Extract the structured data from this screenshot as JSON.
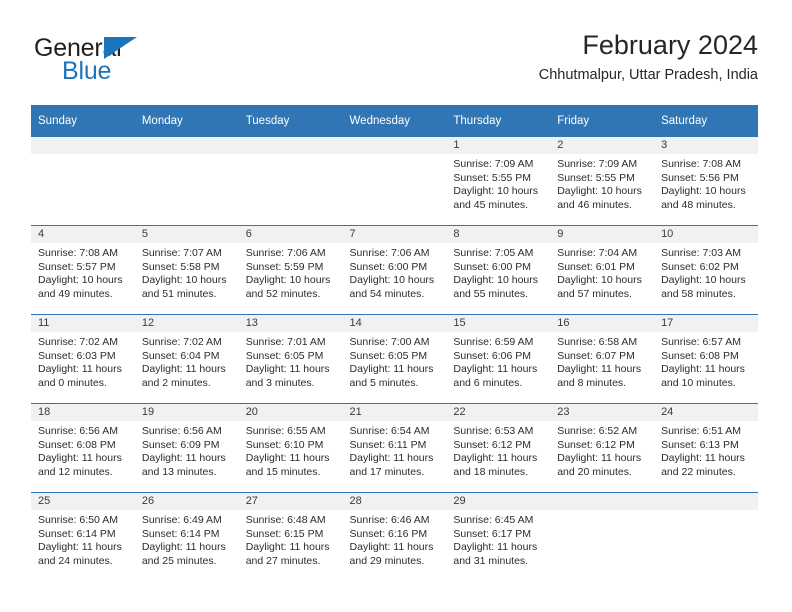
{
  "brand": {
    "name_top": "General",
    "name_bottom": "Blue",
    "flag_icon": "blue-triangle-flag",
    "color_dark": "#231f20",
    "color_blue": "#1b75bb"
  },
  "header": {
    "title": "February 2024",
    "subtitle": "Chhutmalpur, Uttar Pradesh, India"
  },
  "theme": {
    "header_blue": "#3075b4",
    "daynum_band": "#f1f1f1",
    "text": "#2c2c2c"
  },
  "calendar": {
    "weekday_headers": [
      "Sunday",
      "Monday",
      "Tuesday",
      "Wednesday",
      "Thursday",
      "Friday",
      "Saturday"
    ],
    "weeks": [
      [
        {
          "day": "",
          "sunrise": "",
          "sunset": "",
          "daylight_line1": "",
          "daylight_line2": ""
        },
        {
          "day": "",
          "sunrise": "",
          "sunset": "",
          "daylight_line1": "",
          "daylight_line2": ""
        },
        {
          "day": "",
          "sunrise": "",
          "sunset": "",
          "daylight_line1": "",
          "daylight_line2": ""
        },
        {
          "day": "",
          "sunrise": "",
          "sunset": "",
          "daylight_line1": "",
          "daylight_line2": ""
        },
        {
          "day": "1",
          "sunrise": "Sunrise: 7:09 AM",
          "sunset": "Sunset: 5:55 PM",
          "daylight_line1": "Daylight: 10 hours",
          "daylight_line2": "and 45 minutes."
        },
        {
          "day": "2",
          "sunrise": "Sunrise: 7:09 AM",
          "sunset": "Sunset: 5:55 PM",
          "daylight_line1": "Daylight: 10 hours",
          "daylight_line2": "and 46 minutes."
        },
        {
          "day": "3",
          "sunrise": "Sunrise: 7:08 AM",
          "sunset": "Sunset: 5:56 PM",
          "daylight_line1": "Daylight: 10 hours",
          "daylight_line2": "and 48 minutes."
        }
      ],
      [
        {
          "day": "4",
          "sunrise": "Sunrise: 7:08 AM",
          "sunset": "Sunset: 5:57 PM",
          "daylight_line1": "Daylight: 10 hours",
          "daylight_line2": "and 49 minutes."
        },
        {
          "day": "5",
          "sunrise": "Sunrise: 7:07 AM",
          "sunset": "Sunset: 5:58 PM",
          "daylight_line1": "Daylight: 10 hours",
          "daylight_line2": "and 51 minutes."
        },
        {
          "day": "6",
          "sunrise": "Sunrise: 7:06 AM",
          "sunset": "Sunset: 5:59 PM",
          "daylight_line1": "Daylight: 10 hours",
          "daylight_line2": "and 52 minutes."
        },
        {
          "day": "7",
          "sunrise": "Sunrise: 7:06 AM",
          "sunset": "Sunset: 6:00 PM",
          "daylight_line1": "Daylight: 10 hours",
          "daylight_line2": "and 54 minutes."
        },
        {
          "day": "8",
          "sunrise": "Sunrise: 7:05 AM",
          "sunset": "Sunset: 6:00 PM",
          "daylight_line1": "Daylight: 10 hours",
          "daylight_line2": "and 55 minutes."
        },
        {
          "day": "9",
          "sunrise": "Sunrise: 7:04 AM",
          "sunset": "Sunset: 6:01 PM",
          "daylight_line1": "Daylight: 10 hours",
          "daylight_line2": "and 57 minutes."
        },
        {
          "day": "10",
          "sunrise": "Sunrise: 7:03 AM",
          "sunset": "Sunset: 6:02 PM",
          "daylight_line1": "Daylight: 10 hours",
          "daylight_line2": "and 58 minutes."
        }
      ],
      [
        {
          "day": "11",
          "sunrise": "Sunrise: 7:02 AM",
          "sunset": "Sunset: 6:03 PM",
          "daylight_line1": "Daylight: 11 hours",
          "daylight_line2": "and 0 minutes."
        },
        {
          "day": "12",
          "sunrise": "Sunrise: 7:02 AM",
          "sunset": "Sunset: 6:04 PM",
          "daylight_line1": "Daylight: 11 hours",
          "daylight_line2": "and 2 minutes."
        },
        {
          "day": "13",
          "sunrise": "Sunrise: 7:01 AM",
          "sunset": "Sunset: 6:05 PM",
          "daylight_line1": "Daylight: 11 hours",
          "daylight_line2": "and 3 minutes."
        },
        {
          "day": "14",
          "sunrise": "Sunrise: 7:00 AM",
          "sunset": "Sunset: 6:05 PM",
          "daylight_line1": "Daylight: 11 hours",
          "daylight_line2": "and 5 minutes."
        },
        {
          "day": "15",
          "sunrise": "Sunrise: 6:59 AM",
          "sunset": "Sunset: 6:06 PM",
          "daylight_line1": "Daylight: 11 hours",
          "daylight_line2": "and 6 minutes."
        },
        {
          "day": "16",
          "sunrise": "Sunrise: 6:58 AM",
          "sunset": "Sunset: 6:07 PM",
          "daylight_line1": "Daylight: 11 hours",
          "daylight_line2": "and 8 minutes."
        },
        {
          "day": "17",
          "sunrise": "Sunrise: 6:57 AM",
          "sunset": "Sunset: 6:08 PM",
          "daylight_line1": "Daylight: 11 hours",
          "daylight_line2": "and 10 minutes."
        }
      ],
      [
        {
          "day": "18",
          "sunrise": "Sunrise: 6:56 AM",
          "sunset": "Sunset: 6:08 PM",
          "daylight_line1": "Daylight: 11 hours",
          "daylight_line2": "and 12 minutes."
        },
        {
          "day": "19",
          "sunrise": "Sunrise: 6:56 AM",
          "sunset": "Sunset: 6:09 PM",
          "daylight_line1": "Daylight: 11 hours",
          "daylight_line2": "and 13 minutes."
        },
        {
          "day": "20",
          "sunrise": "Sunrise: 6:55 AM",
          "sunset": "Sunset: 6:10 PM",
          "daylight_line1": "Daylight: 11 hours",
          "daylight_line2": "and 15 minutes."
        },
        {
          "day": "21",
          "sunrise": "Sunrise: 6:54 AM",
          "sunset": "Sunset: 6:11 PM",
          "daylight_line1": "Daylight: 11 hours",
          "daylight_line2": "and 17 minutes."
        },
        {
          "day": "22",
          "sunrise": "Sunrise: 6:53 AM",
          "sunset": "Sunset: 6:12 PM",
          "daylight_line1": "Daylight: 11 hours",
          "daylight_line2": "and 18 minutes."
        },
        {
          "day": "23",
          "sunrise": "Sunrise: 6:52 AM",
          "sunset": "Sunset: 6:12 PM",
          "daylight_line1": "Daylight: 11 hours",
          "daylight_line2": "and 20 minutes."
        },
        {
          "day": "24",
          "sunrise": "Sunrise: 6:51 AM",
          "sunset": "Sunset: 6:13 PM",
          "daylight_line1": "Daylight: 11 hours",
          "daylight_line2": "and 22 minutes."
        }
      ],
      [
        {
          "day": "25",
          "sunrise": "Sunrise: 6:50 AM",
          "sunset": "Sunset: 6:14 PM",
          "daylight_line1": "Daylight: 11 hours",
          "daylight_line2": "and 24 minutes."
        },
        {
          "day": "26",
          "sunrise": "Sunrise: 6:49 AM",
          "sunset": "Sunset: 6:14 PM",
          "daylight_line1": "Daylight: 11 hours",
          "daylight_line2": "and 25 minutes."
        },
        {
          "day": "27",
          "sunrise": "Sunrise: 6:48 AM",
          "sunset": "Sunset: 6:15 PM",
          "daylight_line1": "Daylight: 11 hours",
          "daylight_line2": "and 27 minutes."
        },
        {
          "day": "28",
          "sunrise": "Sunrise: 6:46 AM",
          "sunset": "Sunset: 6:16 PM",
          "daylight_line1": "Daylight: 11 hours",
          "daylight_line2": "and 29 minutes."
        },
        {
          "day": "29",
          "sunrise": "Sunrise: 6:45 AM",
          "sunset": "Sunset: 6:17 PM",
          "daylight_line1": "Daylight: 11 hours",
          "daylight_line2": "and 31 minutes."
        },
        {
          "day": "",
          "sunrise": "",
          "sunset": "",
          "daylight_line1": "",
          "daylight_line2": ""
        },
        {
          "day": "",
          "sunrise": "",
          "sunset": "",
          "daylight_line1": "",
          "daylight_line2": ""
        }
      ]
    ]
  }
}
